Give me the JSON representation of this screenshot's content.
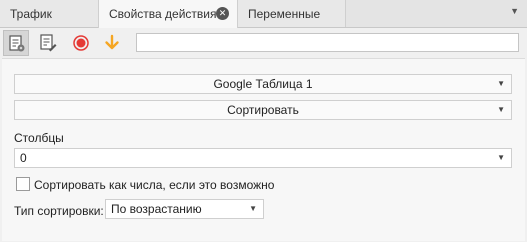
{
  "tabs": [
    {
      "label": "Трафик"
    },
    {
      "label": "Свойства действия"
    },
    {
      "label": "Переменные"
    }
  ],
  "tab_close_glyph": "⊗",
  "toolbar": {
    "icons": [
      "properties-icon",
      "edit-icon",
      "record-icon",
      "download-arrow-icon"
    ],
    "input_value": ""
  },
  "form": {
    "table_select": "Google Таблица 1",
    "action_select": "Сортировать",
    "columns_label": "Столбцы",
    "columns_value": "0",
    "sort_numeric_label": "Сортировать как числа, если это возможно",
    "sort_numeric_checked": false,
    "sort_type_label": "Тип сортировки:",
    "sort_type_value": "По возрастанию"
  },
  "colors": {
    "record": "#e53935",
    "arrow": "#f5a623"
  }
}
